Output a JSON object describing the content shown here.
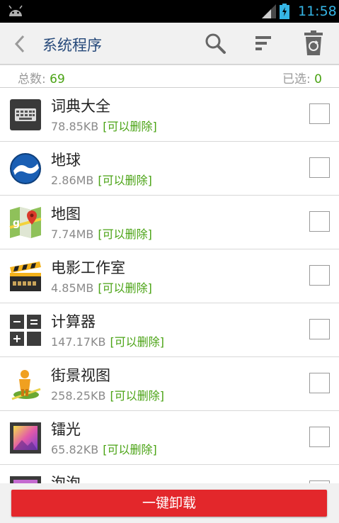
{
  "status_bar": {
    "time": "11:58"
  },
  "header": {
    "title": "系统程序"
  },
  "summary": {
    "total_label": "总数:",
    "total_value": "69",
    "selected_label": "已选:",
    "selected_value": "0"
  },
  "apps": [
    {
      "name": "词典大全",
      "size": "78.85KB",
      "tag": "[可以删除]",
      "icon": "keyboard-icon",
      "checked": false
    },
    {
      "name": "地球",
      "size": "2.86MB",
      "tag": "[可以删除]",
      "icon": "earth-icon",
      "checked": false
    },
    {
      "name": "地图",
      "size": "7.74MB",
      "tag": "[可以删除]",
      "icon": "maps-icon",
      "checked": false
    },
    {
      "name": "电影工作室",
      "size": "4.85MB",
      "tag": "[可以删除]",
      "icon": "clapperboard-icon",
      "checked": false
    },
    {
      "name": "计算器",
      "size": "147.17KB",
      "tag": "[可以删除]",
      "icon": "calculator-icon",
      "checked": false
    },
    {
      "name": "街景视图",
      "size": "258.25KB",
      "tag": "[可以删除]",
      "icon": "street-view-icon",
      "checked": false
    },
    {
      "name": "镭光",
      "size": "65.82KB",
      "tag": "[可以删除]",
      "icon": "gallery-icon",
      "checked": false
    },
    {
      "name": "泡泡",
      "size": "",
      "tag": "",
      "icon": "bubbles-icon",
      "checked": false
    }
  ],
  "footer": {
    "uninstall_label": "一键卸载"
  },
  "colors": {
    "accent_green": "#4aa314",
    "title_blue": "#26497a",
    "clock_blue": "#35b5e5",
    "button_red": "#e3272b"
  }
}
